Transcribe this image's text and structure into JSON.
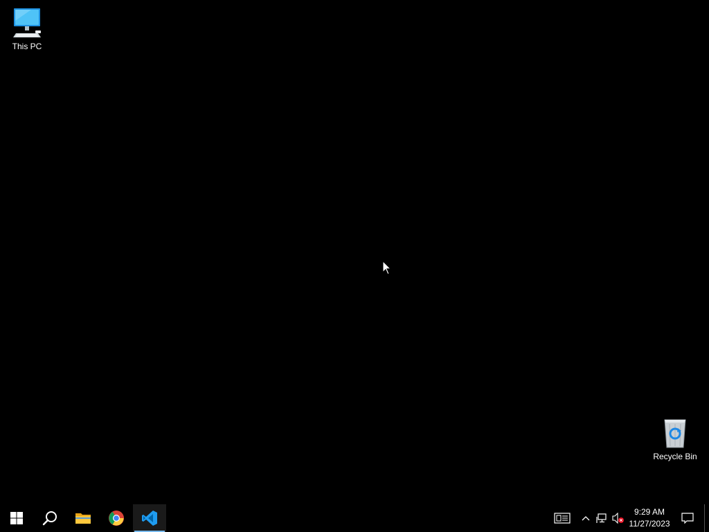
{
  "desktop": {
    "background_color": "#000000",
    "icons": [
      {
        "label": "This PC",
        "icon": "this-pc-icon"
      },
      {
        "label": "Recycle Bin",
        "icon": "recycle-bin-icon"
      }
    ]
  },
  "taskbar": {
    "background_color": "#000000",
    "active_indicator_color": "#76b9ed",
    "pinned": [
      {
        "name": "Start",
        "icon": "windows-logo-icon"
      },
      {
        "name": "Search",
        "icon": "search-icon"
      },
      {
        "name": "File Explorer",
        "icon": "folder-icon"
      },
      {
        "name": "Google Chrome",
        "icon": "chrome-icon"
      },
      {
        "name": "Visual Studio Code",
        "icon": "vscode-icon",
        "active": true
      }
    ],
    "tray": {
      "icons": [
        "news-widget-icon",
        "chevron-up-icon",
        "network-icon",
        "volume-muted-icon",
        "notification-icon"
      ],
      "time": "9:29 AM",
      "date": "11/27/2023"
    }
  }
}
